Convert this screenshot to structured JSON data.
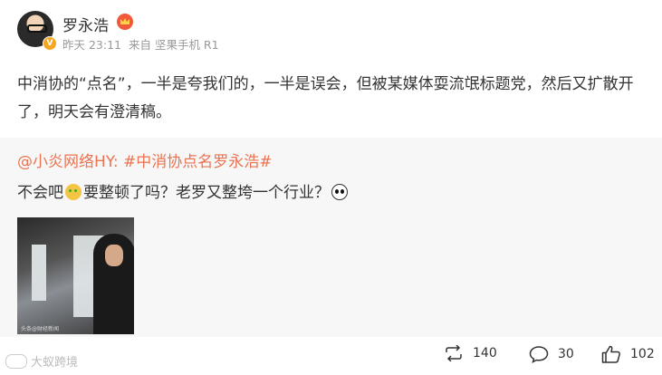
{
  "author": {
    "name": "罗永浩",
    "avatar_icon": "avatar-icon",
    "verified_icon": "verified-v-icon",
    "member_icon": "vip-crown-icon"
  },
  "meta": {
    "time": "昨天 23:11",
    "source": "来自 坚果手机 R1"
  },
  "content": "中消协的“点名”，一半是夸我们的，一半是误会，但被某媒体耍流氓标题党，然后又扩散开了，明天会有澄清稿。",
  "repost": {
    "user": "@小炎网络HY:",
    "hashtag": "#中消协点名罗永浩#",
    "text_part1": "不会吧",
    "text_part2": "要整顿了吗？老罗又整垮一个行业？",
    "emoji1": "cat-emoji-icon",
    "emoji2": "panda-emoji-icon",
    "image_caption": "头条@财经新闻"
  },
  "actions": {
    "repost_count": "140",
    "comment_count": "30",
    "like_count": "102"
  },
  "watermark": "大蚁跨境",
  "colors": {
    "link": "#eb7350",
    "text": "#333333",
    "meta": "#999999",
    "repost_bg": "#f7f7f7"
  }
}
